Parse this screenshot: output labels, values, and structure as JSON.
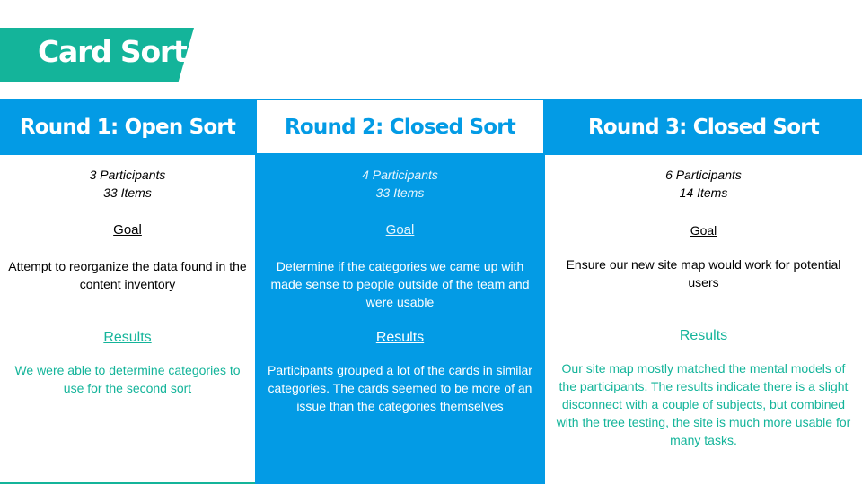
{
  "title": "Card Sorts",
  "colors": {
    "accent_green": "#14b49a",
    "accent_blue": "#039be5",
    "text_dark": "#000000",
    "text_light": "#ffffff"
  },
  "rounds": [
    {
      "heading": "Round 1: Open Sort",
      "participants": "3 Participants",
      "items": "33 Items",
      "goal_label": "Goal",
      "goal_text": "Attempt to reorganize the data found in the content inventory",
      "results_label": "Results",
      "results_text": "We were able to determine categories to use for the second sort"
    },
    {
      "heading": "Round 2: Closed Sort",
      "participants": "4 Participants",
      "items": "33 Items",
      "goal_label": "Goal",
      "goal_text": "Determine if the categories we came up with made sense to people outside of the team and were usable",
      "results_label": "Results",
      "results_text": "Participants grouped a lot of the cards in similar categories. The cards seemed to be more of an issue than the categories themselves"
    },
    {
      "heading": "Round 3: Closed Sort",
      "participants": "6 Participants",
      "items": "14 Items",
      "goal_label": "Goal",
      "goal_text": "Ensure our new site map would work for potential users",
      "results_label": "Results",
      "results_text": "Our site map mostly matched the mental models of the participants. The results indicate there is a slight disconnect with a couple of subjects, but combined with the tree testing, the site is much more usable for many tasks."
    }
  ]
}
